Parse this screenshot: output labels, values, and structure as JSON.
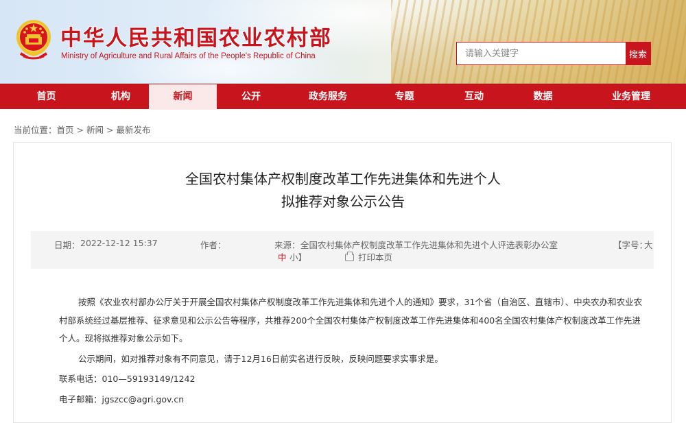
{
  "header": {
    "title": "中华人民共和国农业农村部",
    "subtitle": "Ministry of Agriculture and Rural Affairs of the People's Republic of China",
    "search_placeholder": "请输入关键字",
    "search_button": "搜索",
    "emblem_icon": "national-emblem-icon"
  },
  "nav": {
    "items": [
      {
        "label": "首页"
      },
      {
        "label": "机构"
      },
      {
        "label": "新闻"
      },
      {
        "label": "公开"
      },
      {
        "label": "政务服务"
      },
      {
        "label": "专题"
      },
      {
        "label": "互动"
      },
      {
        "label": "数据"
      },
      {
        "label": "业务管理"
      }
    ],
    "active_index": 2
  },
  "breadcrumb": {
    "prefix": "当前位置：",
    "items": [
      "首页",
      "新闻",
      "最新发布"
    ],
    "separator": ">"
  },
  "article": {
    "title_line1": "全国农村集体产权制度改革工作先进集体和先进个人",
    "title_line2": "拟推荐对象公示公告",
    "meta": {
      "date_label": "日期：",
      "date": "2022-12-12 15:37",
      "author_label": "作者：",
      "author": "",
      "source_label": "来源：",
      "source": "全国农村集体产权制度改革工作先进集体和先进个人评选表彰办公室",
      "font_label": "【字号：",
      "font_large": "大",
      "font_medium": "中",
      "font_small": "小】",
      "print_label": "打印本页",
      "print_icon": "printer-icon"
    },
    "paragraphs": [
      "按照《农业农村部办公厅关于开展全国农村集体产权制度改革工作先进集体和先进个人的通知》要求，31个省（自治区、直辖市）、中央农办和农业农村部系统经过基层推荐、征求意见和公示公告等程序，共推荐200个全国农村集体产权制度改革工作先进集体和400名全国农村集体产权制度改革工作先进个人。现将拟推荐对象公示如下。",
      "公示期间，如对推荐对象有不同意见，请于12月16日前实名进行反映，反映问题要求实事求是。"
    ],
    "phone_label": "联系电话：",
    "phone": "010—59193149/1242",
    "email_label": "电子邮箱：",
    "email": "jgszcc@agri.gov.cn"
  },
  "colors": {
    "brand_red": "#c8151d",
    "active_nav_bg": "#fbe9e9",
    "meta_bg": "#f4f4f4"
  }
}
